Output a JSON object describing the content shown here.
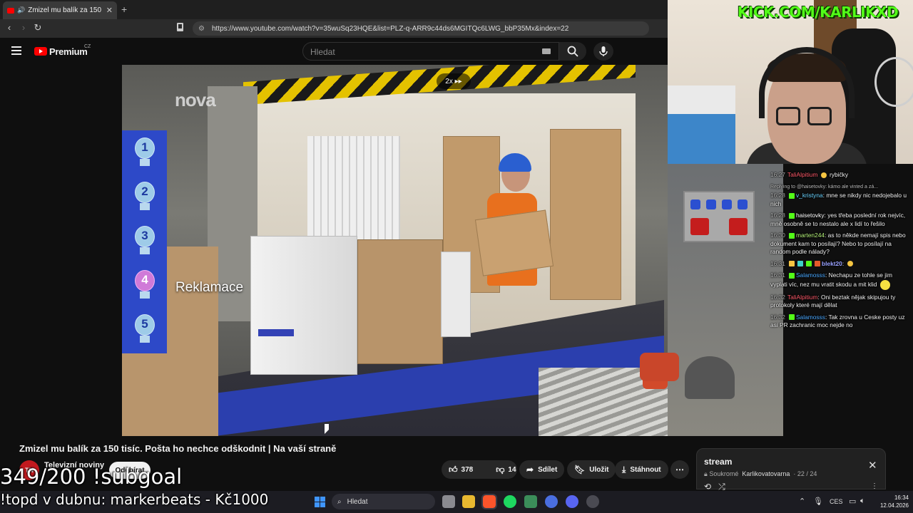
{
  "browser": {
    "tab_title": "Zmizel mu balík za 150 tisíc. Pošta ho nechce odškodnit",
    "tab_close": "✕",
    "new_tab": "+",
    "url": "https://www.youtube.com/watch?v=35wuSq23HQE&list=PLZ-q-ARR9c44ds6MGITQc6LWG_bbP35Mx&index=22",
    "back": "‹",
    "forward": "›",
    "reload": "↻"
  },
  "youtube": {
    "brand": "Premium",
    "brand_country": "CZ",
    "search_placeholder": "Hledat"
  },
  "video": {
    "watermark": "nova",
    "speed": "2x ▸▸",
    "topic_numbers": [
      "1",
      "2",
      "3",
      "4",
      "5"
    ],
    "active_topic": 4,
    "topic_label": "Reklamace",
    "title": "Zmizel mu balík za 150 tisíc. Pošta ho nechce odškodnit | Na vaší straně"
  },
  "channel": {
    "avatar": "TN",
    "name": "Televizní noviny",
    "subs": "",
    "subscribe": "Odebírat"
  },
  "actions": {
    "likes": "378",
    "dislikes": "14",
    "share": "Sdílet",
    "save": "Uložit",
    "download": "Stáhnout",
    "more": "⋯"
  },
  "playlist": {
    "title": "stream",
    "privacy": "Soukromé",
    "owner": "Karlikovatovarna",
    "position": "22 / 24",
    "close": "✕"
  },
  "overlays": {
    "subgoal": "349/200 !subgoal",
    "topd": "!topd v dubnu: markerbeats - Kč1000"
  },
  "stream": {
    "kick": "KICK.COM/KARLIKXD"
  },
  "chat": [
    {
      "time": "16:27",
      "user": "TaliAlpitium",
      "color": "u-red",
      "text": "rybičky"
    },
    {
      "reply": "Replying to @haisetovky: kámo ale vinted a zá..."
    },
    {
      "time": "16:28",
      "user": "v_kristyna",
      "color": "u-cyan",
      "text": "mne se nikdy nic nedojebalo u nich"
    },
    {
      "time": "16:28",
      "user": "haisetovky",
      "color": "u-white",
      "text": "yes třeba poslední rok nejvíc, mně osobně se to nestalo ale x lidí to řešilo"
    },
    {
      "time": "16:30",
      "user": "marten244",
      "color": "u-green",
      "text": "as to někde nemají spis nebo dokument kam to posílají? Nebo to posílají na random podle nálady?"
    },
    {
      "time": "16:31",
      "user": "blekt20",
      "color": "u-purple",
      "text": ""
    },
    {
      "time": "16:31",
      "user": "Salamosss",
      "color": "u-blue",
      "text": "Nechapu ze tohle se jim vyplati víc, nez mu vratit skodu a mit klid"
    },
    {
      "time": "16:32",
      "user": "TaliAlpitium",
      "color": "u-red",
      "text": "Oni beztak nějak skipujou ty protokoly které mají dělat"
    },
    {
      "time": "16:32",
      "user": "Salamosss",
      "color": "u-blue",
      "text": "Tak zrovna u Ceske posty uz asi PR zachranic moc nejde no"
    }
  ],
  "taskbar": {
    "search": "Hledat",
    "lang": "CES",
    "time": "16:34",
    "date": "12.04.2026"
  },
  "colors": {
    "yt_red": "#ff0000",
    "kick_green": "#53fc18",
    "topic_panel": "#2d49c8"
  }
}
